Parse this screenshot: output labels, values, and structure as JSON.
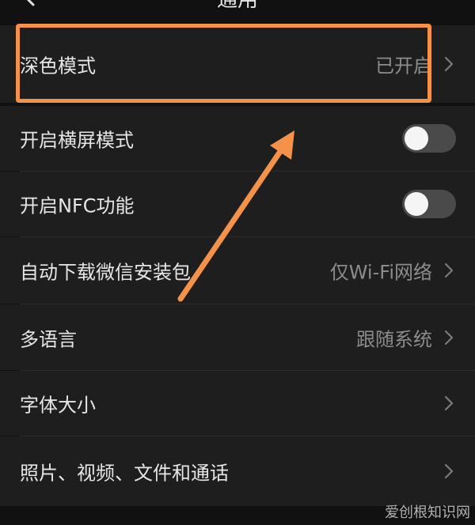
{
  "header": {
    "title": "通用",
    "back_icon": "chevron-left-icon"
  },
  "settings": {
    "dark_mode": {
      "label": "深色模式",
      "value": "已开启"
    },
    "landscape": {
      "label": "开启横屏模式",
      "enabled": false
    },
    "nfc": {
      "label": "开启NFC功能",
      "enabled": false
    },
    "auto_download": {
      "label": "自动下载微信安装包",
      "value": "仅Wi-Fi网络"
    },
    "language": {
      "label": "多语言",
      "value": "跟随系统"
    },
    "font_size": {
      "label": "字体大小"
    },
    "media": {
      "label": "照片、视频、文件和通话"
    }
  },
  "annotation": {
    "color": "#f4924a"
  },
  "watermark": {
    "text": "爱创根知识网"
  },
  "colors": {
    "background": "#111111",
    "row_background": "#1e1e1e",
    "primary_text": "#e6e6e6",
    "secondary_text": "#8c8c8c",
    "accent": "#f4924a"
  }
}
